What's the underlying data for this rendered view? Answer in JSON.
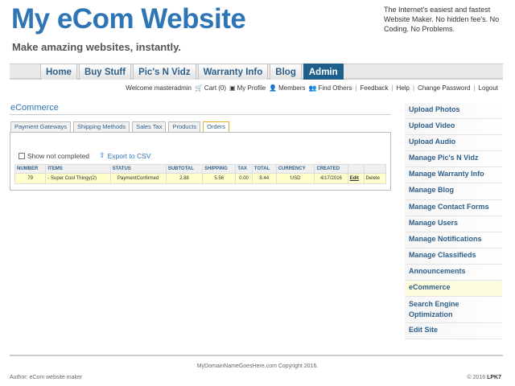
{
  "header": {
    "site_title": "My eCom Website",
    "tagline": "Make amazing websites, instantly.",
    "promo": "The Internet's easiest and fastest Website Maker. No hidden fee's. No Coding. No Problems."
  },
  "nav": {
    "tabs": [
      {
        "label": "Home"
      },
      {
        "label": "Buy Stuff"
      },
      {
        "label": "Pic's N Vidz"
      },
      {
        "label": "Warranty Info"
      },
      {
        "label": "Blog"
      },
      {
        "label": "Admin",
        "active": true
      }
    ]
  },
  "userbar": {
    "welcome": "Welcome masteradmin",
    "cart": "Cart (0)",
    "profile": "My Profile",
    "members": "Members",
    "find_others": "Find Others",
    "feedback": "Feedback",
    "help": "Help",
    "change_password": "Change Password",
    "logout": "Logout",
    "separator": "|"
  },
  "main": {
    "heading": "eCommerce",
    "subtabs": [
      {
        "label": "Payment Gateways"
      },
      {
        "label": "Shipping Methods"
      },
      {
        "label": "Sales Tax"
      },
      {
        "label": "Products"
      },
      {
        "label": "Orders",
        "active": true
      }
    ],
    "filter_label": "Show not completed",
    "export_label": "Export to CSV",
    "table": {
      "headers": [
        "NUMBER",
        "ITEMS",
        "STATUS",
        "SUBTOTAL",
        "SHIPPING",
        "TAX",
        "TOTAL",
        "CURRENCY",
        "CREATED",
        "",
        ""
      ],
      "rows": [
        {
          "number": "79",
          "items": "- Super Cool Thingy(2)",
          "status": "PaymentConfirmed",
          "subtotal": "2.88",
          "shipping": "5.56",
          "tax": "0.00",
          "total": "8.44",
          "currency": "USD",
          "created": "4/17/2016",
          "edit": "Edit",
          "delete": "Delete"
        }
      ]
    }
  },
  "sidebar": {
    "items": [
      {
        "label": "Upload Photos"
      },
      {
        "label": "Upload Video"
      },
      {
        "label": "Upload Audio"
      },
      {
        "label": "Manage Pic's N Vidz"
      },
      {
        "label": "Manage Warranty Info"
      },
      {
        "label": "Manage Blog"
      },
      {
        "label": "Manage Contact Forms"
      },
      {
        "label": "Manage Users"
      },
      {
        "label": "Manage Notifications"
      },
      {
        "label": "Manage Classifieds"
      },
      {
        "label": "Announcements"
      },
      {
        "label": "eCommerce",
        "active": true
      },
      {
        "label": "Search Engine Optimization"
      },
      {
        "label": "Edit Site"
      }
    ]
  },
  "footer": {
    "copyright": "MyDomainNameGoesHere.com Copyright 2016.",
    "author": "Author: eCom website maker",
    "year_text": "© 2016",
    "brand": "LPK7"
  },
  "colors": {
    "brand_blue": "#2e75b6",
    "nav_active": "#1f5f8b",
    "row_highlight": "#ffffcc",
    "status_green": "#2a8a2a"
  },
  "icons": {
    "cart": "cart-icon",
    "profile": "profile-icon",
    "members": "members-icon",
    "find_others": "find-others-icon",
    "export": "export-icon"
  }
}
